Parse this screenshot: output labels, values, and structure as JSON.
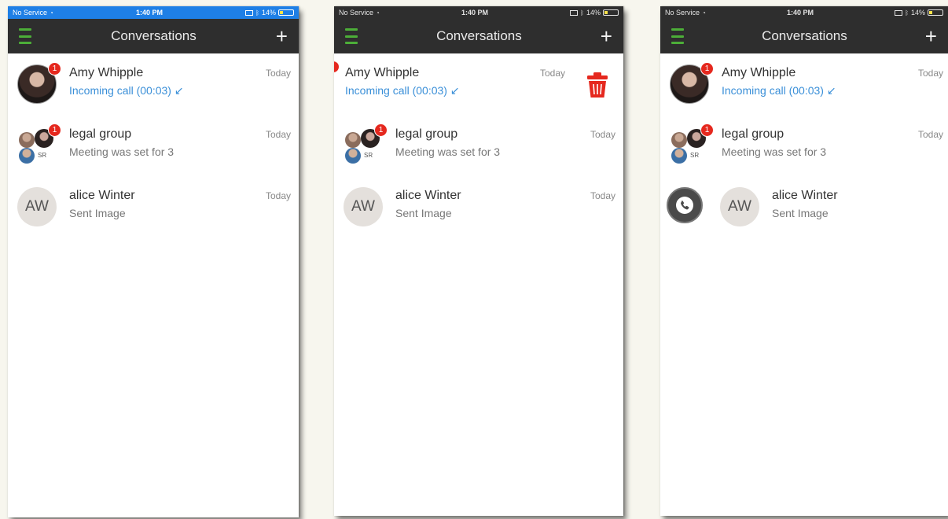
{
  "statusbar": {
    "carrier": "No Service",
    "time": "1:40 PM",
    "battery": "14%"
  },
  "navbar": {
    "title": "Conversations",
    "add_label": "+"
  },
  "conversations": [
    {
      "name": "Amy Whipple",
      "subtitle": "Incoming call (00:03) ↙",
      "time": "Today",
      "badge": "1"
    },
    {
      "name": "legal group",
      "subtitle": "Meeting was set for 3",
      "time": "Today",
      "badge": "1",
      "group_initials": "SR"
    },
    {
      "name": "alice Winter",
      "subtitle": "Sent Image",
      "time": "Today",
      "initials": "AW"
    }
  ],
  "colors": {
    "statusbar_blue": "#1e7fe6",
    "navbar": "#2e2e2e",
    "menu_green": "#4cae38",
    "badge_red": "#e5281e",
    "incoming_blue": "#3a8fd8",
    "delete_red": "#e5281e"
  },
  "icons": {
    "menu": "menu-icon",
    "add": "plus-icon",
    "delete": "trash-icon",
    "call": "phone-icon"
  }
}
